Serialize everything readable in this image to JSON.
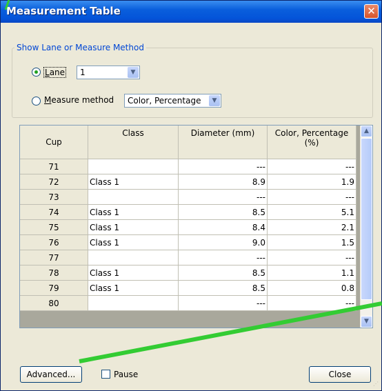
{
  "window": {
    "title": "Measurement Table",
    "close_glyph": "✕"
  },
  "method_group": {
    "label": "Show Lane or Measure Method",
    "lane_label": "Lane",
    "lane_value": "1",
    "measure_label": "Measure method",
    "measure_value": "Color, Percentage",
    "selected": "lane"
  },
  "table": {
    "columns": [
      "Cup",
      "Class",
      "Diameter (mm)",
      "Color, Percentage (%)"
    ],
    "rows": [
      {
        "cup": "71",
        "class": "",
        "diameter": "---",
        "color": "---"
      },
      {
        "cup": "72",
        "class": "Class 1",
        "diameter": "8.9",
        "color": "1.9"
      },
      {
        "cup": "73",
        "class": "",
        "diameter": "---",
        "color": "---"
      },
      {
        "cup": "74",
        "class": "Class 1",
        "diameter": "8.5",
        "color": "5.1"
      },
      {
        "cup": "75",
        "class": "Class 1",
        "diameter": "8.4",
        "color": "2.1"
      },
      {
        "cup": "76",
        "class": "Class 1",
        "diameter": "9.0",
        "color": "1.5"
      },
      {
        "cup": "77",
        "class": "",
        "diameter": "---",
        "color": "---"
      },
      {
        "cup": "78",
        "class": "Class 1",
        "diameter": "8.5",
        "color": "1.1"
      },
      {
        "cup": "79",
        "class": "Class 1",
        "diameter": "8.5",
        "color": "0.8"
      },
      {
        "cup": "80",
        "class": "",
        "diameter": "---",
        "color": "---"
      }
    ]
  },
  "footer": {
    "advanced_label": "Advanced...",
    "pause_label": "Pause",
    "close_label": "Close"
  },
  "icons": {
    "dropdown": "chevron-down-icon",
    "scroll_up": "chevron-up-icon",
    "scroll_down": "chevron-down-icon",
    "window_close": "close-icon"
  },
  "colors": {
    "titlebar": "#0454d9",
    "group_label": "#0046d5",
    "annotation": "#33cc33"
  }
}
